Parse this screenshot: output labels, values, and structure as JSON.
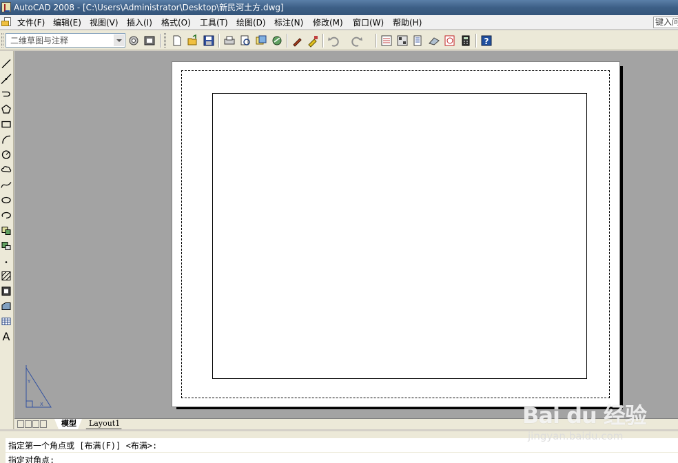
{
  "window": {
    "title": "AutoCAD 2008 - [C:\\Users\\Administrator\\Desktop\\新民河土方.dwg]"
  },
  "menu": {
    "items": [
      "文件(F)",
      "编辑(E)",
      "视图(V)",
      "插入(I)",
      "格式(O)",
      "工具(T)",
      "绘图(D)",
      "标注(N)",
      "修改(M)",
      "窗口(W)",
      "帮助(H)"
    ],
    "help_placeholder": "键入问"
  },
  "toolbar": {
    "workspace_value": "二维草图与注释",
    "standard_icons": [
      "workspace-settings-icon",
      "my-workspace-icon",
      "new-file-icon",
      "open-file-icon",
      "save-icon",
      "plot-icon",
      "plot-preview-icon",
      "publish-icon",
      "3d-dwf-icon",
      "matchprop-icon",
      "block-editor-icon",
      "undo-icon",
      "redo-icon",
      "properties-icon",
      "design-center-icon",
      "tool-palettes-icon",
      "sheet-set-icon",
      "markup-icon",
      "calculator-icon",
      "help-icon"
    ]
  },
  "draw_toolbar": {
    "icons": [
      "line-icon",
      "construction-line-icon",
      "polyline-icon",
      "polygon-icon",
      "rectangle-icon",
      "arc-icon",
      "circle-icon",
      "revision-cloud-icon",
      "spline-icon",
      "ellipse-icon",
      "ellipse-arc-icon",
      "insert-block-icon",
      "make-block-icon",
      "point-icon",
      "hatch-icon",
      "gradient-icon",
      "region-icon",
      "table-icon",
      "multiline-text-icon"
    ],
    "text_tool_label": "A"
  },
  "tabs": {
    "items": [
      "模型",
      "Layout1"
    ],
    "active": "Layout1"
  },
  "command": {
    "prompt": "指定第一个角点或 [布满(F)] <布满>:",
    "second_line": "指定对角点:"
  },
  "watermark": {
    "brand": "Bai du 经验",
    "url": "jingyan.baidu.com"
  },
  "colors": {
    "titlebar": "#3d5f86",
    "workspace_bg": "#a3a3a3",
    "paper": "#ffffff",
    "chrome": "#ece9d8"
  }
}
